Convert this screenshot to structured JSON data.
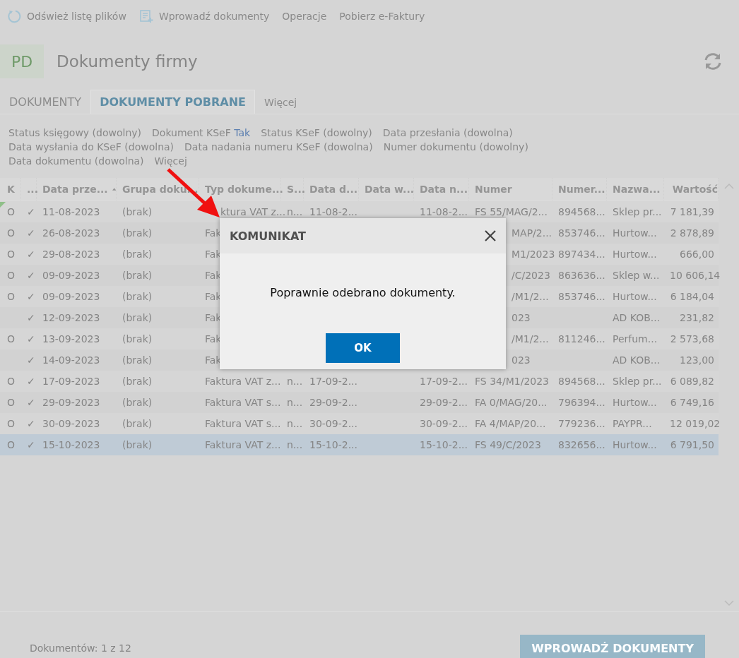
{
  "toolbar": [
    {
      "kind": "refresh",
      "label": "Odśwież listę plików"
    },
    {
      "kind": "add-doc",
      "label": "Wprowadź dokumenty"
    },
    {
      "kind": "plain",
      "label": "Operacje"
    },
    {
      "kind": "plain",
      "label": "Pobierz e-Faktury"
    }
  ],
  "header": {
    "badge": "PD",
    "title": "Dokumenty firmy"
  },
  "tabs": [
    {
      "label": "DOKUMENTY",
      "selected": false
    },
    {
      "label": "DOKUMENTY POBRANE",
      "selected": true
    },
    {
      "label": "Więcej",
      "selected": false
    }
  ],
  "filters": {
    "lines": [
      [
        {
          "label": "Status księgowy (dowolny)"
        },
        {
          "label": "Dokument KSeF",
          "value": "Tak"
        },
        {
          "label": "Status KSeF (dowolny)"
        },
        {
          "label": "Data przesłania (dowolna)"
        }
      ],
      [
        {
          "label": "Data wysłania do KSeF (dowolna)"
        },
        {
          "label": "Data nadania numeru KSeF (dowolna)"
        },
        {
          "label": "Numer dokumentu (dowolny)"
        }
      ],
      [
        {
          "label": "Data dokumentu (dowolna)"
        }
      ]
    ],
    "more_link": "Więcej"
  },
  "table": {
    "columns": [
      {
        "label": "K"
      },
      {
        "label": "..."
      },
      {
        "label": "Data prze...",
        "sorted": true
      },
      {
        "label": "Grupa doku..."
      },
      {
        "label": "Typ dokume..."
      },
      {
        "label": "S..."
      },
      {
        "label": "Data d..."
      },
      {
        "label": "Data w..."
      },
      {
        "label": "Data n..."
      },
      {
        "label": "Numer"
      },
      {
        "label": "Numer..."
      },
      {
        "label": "Nazwa..."
      },
      {
        "label": "Wartość"
      }
    ],
    "rows": [
      {
        "selected": false,
        "cells": [
          "O",
          "✓",
          "11-08-2023",
          "(brak)",
          {
            "text": "ktura VAT z...",
            "clipped": true
          },
          "n...",
          "11-08-2...",
          null,
          "11-08-2...",
          "FS 55/MAG/2...",
          "894568...",
          "Sklep pr...",
          "7 181,39"
        ]
      },
      {
        "selected": false,
        "cells": [
          "O",
          "✓",
          "26-08-2023",
          "(brak)",
          "Fak",
          null,
          null,
          null,
          null,
          {
            "text": "MAP/2...",
            "clipped": true
          },
          "853746...",
          "Hurtow...",
          "2 878,89"
        ]
      },
      {
        "selected": false,
        "cells": [
          "O",
          "✓",
          "29-08-2023",
          "(brak)",
          "Fak",
          null,
          null,
          null,
          null,
          {
            "text": "M1/2023",
            "clipped": true
          },
          "897434...",
          "Hurtow...",
          "666,00"
        ]
      },
      {
        "selected": false,
        "cells": [
          "O",
          "✓",
          "09-09-2023",
          "(brak)",
          "Fak",
          null,
          null,
          null,
          null,
          {
            "text": "/C/2023",
            "clipped": true
          },
          "863636...",
          "Sklep w...",
          "10 606,14"
        ]
      },
      {
        "selected": false,
        "cells": [
          "O",
          "✓",
          "09-09-2023",
          "(brak)",
          "Fak",
          null,
          null,
          null,
          null,
          {
            "text": "/M1/2...",
            "clipped": true
          },
          "853746...",
          "Hurtow...",
          "6 184,04"
        ]
      },
      {
        "selected": false,
        "cells": [
          null,
          "✓",
          "12-09-2023",
          "(brak)",
          "Fak",
          null,
          null,
          null,
          null,
          {
            "text": "023",
            "clipped": true
          },
          null,
          "AD KOB...",
          "231,82"
        ]
      },
      {
        "selected": false,
        "cells": [
          "O",
          "✓",
          "13-09-2023",
          "(brak)",
          "Fak",
          null,
          null,
          null,
          null,
          {
            "text": "/M1/2...",
            "clipped": true
          },
          "811246...",
          "Perfum...",
          "2 573,68"
        ]
      },
      {
        "selected": false,
        "cells": [
          null,
          "✓",
          "14-09-2023",
          "(brak)",
          "Fak",
          null,
          null,
          null,
          null,
          {
            "text": "023",
            "clipped": true
          },
          null,
          "AD KOB...",
          "123,00"
        ]
      },
      {
        "selected": false,
        "cells": [
          "O",
          "✓",
          "17-09-2023",
          "(brak)",
          "Faktura VAT z...",
          "n...",
          "17-09-2...",
          null,
          "17-09-2...",
          "FS 34/M1/2023",
          "894568...",
          "Sklep pr...",
          "6 089,82"
        ]
      },
      {
        "selected": false,
        "cells": [
          "O",
          "✓",
          "29-09-2023",
          "(brak)",
          "Faktura VAT s...",
          "n...",
          "29-09-2...",
          null,
          "29-09-2...",
          "FA 0/MAG/20...",
          "796394...",
          "Hurtow...",
          "6 749,16"
        ]
      },
      {
        "selected": false,
        "cells": [
          "O",
          "✓",
          "30-09-2023",
          "(brak)",
          "Faktura VAT s...",
          "n...",
          "30-09-2...",
          null,
          "30-09-2...",
          "FA 4/MAP/20...",
          "779236...",
          "PAYPR...",
          "12 019,02"
        ]
      },
      {
        "selected": true,
        "cells": [
          "O",
          "✓",
          "15-10-2023",
          "(brak)",
          "Faktura VAT z...",
          "n...",
          "15-10-2...",
          null,
          "15-10-2...",
          "FS 49/C/2023",
          "832656...",
          "Hurtow...",
          "6 791,50"
        ]
      }
    ]
  },
  "footer": {
    "count": "Dokumentów: 1 z 12",
    "button": "WPROWADŹ DOKUMENTY"
  },
  "dialog": {
    "title": "KOMUNIKAT",
    "message": "Poprawnie odebrano dokumenty.",
    "button": "OK"
  }
}
